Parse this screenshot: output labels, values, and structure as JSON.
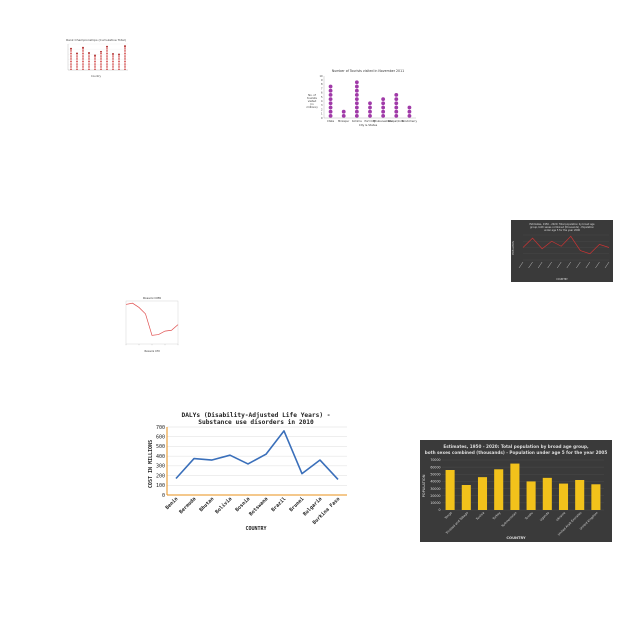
{
  "chart_data": [
    {
      "id": "c1",
      "type": "bar",
      "title": "Rank Championships (Cumulative Total)",
      "xlabel": "Country",
      "ylabel": "",
      "categories": [
        "",
        "",
        "",
        "",
        "",
        "",
        "",
        "",
        "",
        ""
      ],
      "values": [
        8.2,
        6.4,
        8.6,
        6.6,
        5.6,
        7.0,
        9.0,
        6.2,
        6.0,
        9.2
      ],
      "ylim": [
        0,
        10
      ],
      "grid": true,
      "colors": {
        "bar": "#cc3333",
        "dot": "#aa2222"
      }
    },
    {
      "id": "c2",
      "type": "scatter",
      "title": "Number of Tourists visited in November 2011",
      "xlabel": "City & States",
      "ylabel": "No. of tourists visited (in millions)",
      "categories": [
        "Ctata",
        "Mirzapur",
        "Kohima",
        "Port City",
        "Bhubaneshwar",
        "Bhopal/Indor",
        "Pondicherry"
      ],
      "values": [
        8,
        2,
        8.5,
        4,
        4.5,
        5.5,
        2.5
      ],
      "ylim": [
        0,
        10
      ],
      "yticks": [
        0,
        1,
        2,
        3,
        4,
        5,
        6,
        7,
        8,
        9,
        10
      ],
      "colors": {
        "dot": "#a03aa8"
      }
    },
    {
      "id": "c3",
      "type": "line",
      "title": "Estimates, 1950 - 2020: Total population by broad age group, both sexes combined (thousands) - Population under age 5 for the year 2000",
      "xlabel": "COUNTRY",
      "ylabel": "POPULATION",
      "categories": [
        "",
        "",
        "",
        "",
        "",
        "",
        "",
        "",
        "",
        ""
      ],
      "values": [
        20000,
        35000,
        18000,
        30000,
        22000,
        38000,
        15000,
        10000,
        25000,
        20000
      ],
      "ylim": [
        0,
        40000
      ],
      "colors": {
        "background": "#3a3a3a",
        "line": "#cc3333",
        "text": "#dddddd"
      }
    },
    {
      "id": "c4",
      "type": "line",
      "title": "Rossini CM6",
      "xlabel": "Rossini CM",
      "ylabel": "",
      "values": [
        92,
        95,
        85,
        70,
        20,
        22,
        30,
        32,
        45
      ],
      "ylim": [
        0,
        100
      ],
      "colors": {
        "line": "#e05050"
      }
    },
    {
      "id": "c5",
      "type": "line",
      "title": "DALYs (Disability-Adjusted Life Years) - Substance use disorders in 2010",
      "xlabel": "COUNTRY",
      "ylabel": "COST IN MILLIONS",
      "categories": [
        "Benin",
        "Bermuda",
        "Bhutan",
        "Bolivia",
        "Bosnia",
        "Botswana",
        "Brazil",
        "Brunei",
        "Bulgaria",
        "Burkina Faso"
      ],
      "values": [
        170,
        375,
        360,
        410,
        320,
        420,
        660,
        220,
        360,
        160
      ],
      "ylim": [
        0,
        700
      ],
      "yticks": [
        0,
        100,
        200,
        300,
        400,
        500,
        600,
        700
      ],
      "grid": true,
      "colors": {
        "line": "#3a6fba",
        "axis": "#e8901a",
        "grid": "#dddddd"
      }
    },
    {
      "id": "c6",
      "type": "bar",
      "title": "Estimates, 1950 - 2020: Total population by broad age group, both sexes combined (thousands) - Population under age 5 for the year 2005",
      "xlabel": "COUNTRY",
      "ylabel": "POPULATION",
      "categories": [
        "Tonga",
        "Trinidad and Tobago",
        "Tunisia",
        "Turkey",
        "Turkmenistan",
        "Tuvalu",
        "Uganda",
        "Ukraine",
        "United Arab Emirates",
        "United Kingdom",
        "United Republic of Tanzania",
        "United States of America"
      ],
      "values": [
        56000,
        35000,
        46000,
        57000,
        65000,
        40000,
        45000,
        37000,
        42000,
        36000
      ],
      "ylim": [
        0,
        70000
      ],
      "yticks": [
        0,
        10000,
        20000,
        30000,
        40000,
        50000,
        60000,
        70000
      ],
      "colors": {
        "background": "#3a3a3a",
        "bar": "#f2c21b",
        "text": "#dddddd",
        "grid": "#555555"
      }
    }
  ]
}
